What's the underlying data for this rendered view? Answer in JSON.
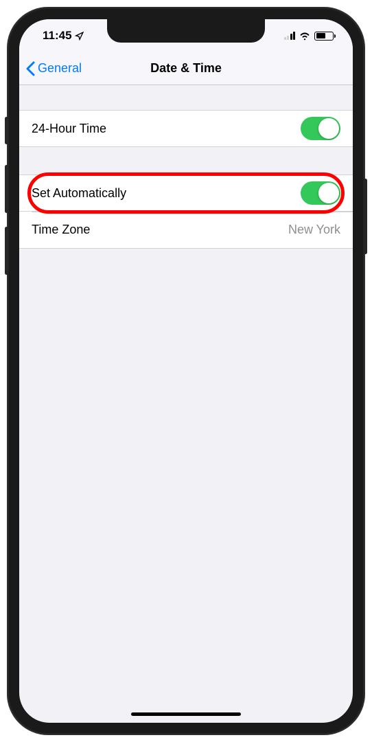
{
  "status": {
    "time": "11:45"
  },
  "nav": {
    "back_label": "General",
    "title": "Date & Time"
  },
  "cells": {
    "twenty_four_hour": {
      "label": "24-Hour Time",
      "enabled": true
    },
    "set_auto": {
      "label": "Set Automatically",
      "enabled": true
    },
    "time_zone": {
      "label": "Time Zone",
      "value": "New York"
    }
  }
}
